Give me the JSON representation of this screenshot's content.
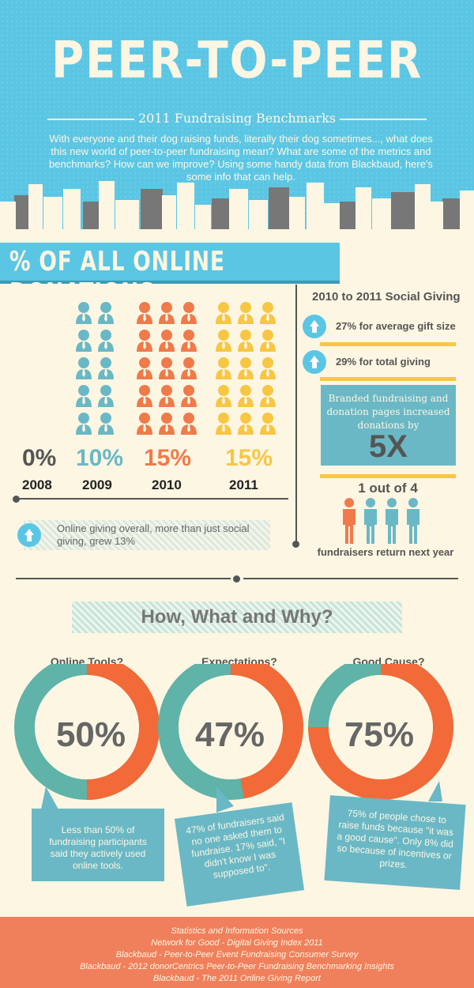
{
  "header": {
    "title": "PEER-TO-PEER",
    "subtitle": "2011 Fundraising Benchmarks",
    "intro": "With everyone and their dog raising funds, literally their dog sometimes..., what does this new world of peer-to-peer fundraising mean? What are some of the metrics and benchmarks? How can we improve? Using some handy data from Blackbaud, here's some info that can help."
  },
  "online_donations": {
    "heading": "% OF ALL ONLINE DONATIONS",
    "years": [
      {
        "pct": "0%",
        "year": "2008",
        "color": "#555555",
        "figures": 0
      },
      {
        "pct": "10%",
        "year": "2009",
        "color": "#6ab8c5",
        "figures": 10
      },
      {
        "pct": "15%",
        "year": "2010",
        "color": "#f07a4a",
        "figures": 15
      },
      {
        "pct": "15%",
        "year": "2011",
        "color": "#f7c743",
        "figures": 15
      }
    ],
    "online_giving_note": "Online giving overall, more than just social giving, grew 13%"
  },
  "social_giving": {
    "title": "2010 to 2011 Social Giving",
    "stat1": "27% for average gift size",
    "stat2": "29% for total giving",
    "branded_text": "Branded fundraising and donation pages increased donations by",
    "branded_multiplier": "5X",
    "one_out_of": "1 out of 4",
    "fundraisers_return": "fundraisers return next year"
  },
  "how_what_why": {
    "heading": "How, What and Why?",
    "items": [
      {
        "question": "Online Tools?",
        "value": "50%",
        "fraction": 0.5,
        "note": "Less than 50% of fundraising participants said they actively used online tools."
      },
      {
        "question": "Expectations?",
        "value": "47%",
        "fraction": 0.47,
        "note": "47% of fundraisers said no one asked them to fundraise. 17% said, \"I didn't know I was supposed to\"."
      },
      {
        "question": "Good Cause?",
        "value": "75%",
        "fraction": 0.75,
        "note": "75% of people chose to raise funds because \"it was a good cause\". Only 8% did so because of incentives or prizes."
      }
    ]
  },
  "footer": {
    "lines": [
      "Statistics and Information Sources",
      "Network for Good - Digital Giving Index 2011",
      "Blackbaud - Peer-to-Peer Event Fundraising Consumer Survey",
      "Blackbaud - 2012 donorCentrics Peer-to-Peer Fundraising Benchmarking Insights",
      "Blackbaud - The 2011 Online Giving Report"
    ]
  },
  "colors": {
    "sky": "#5bc6e4",
    "cream": "#fdf6e3",
    "teal": "#6ab8c5",
    "orange": "#f07a4a",
    "yellow": "#f7c743",
    "donut_teal": "#5fb3a8",
    "donut_orange": "#f26a38"
  }
}
